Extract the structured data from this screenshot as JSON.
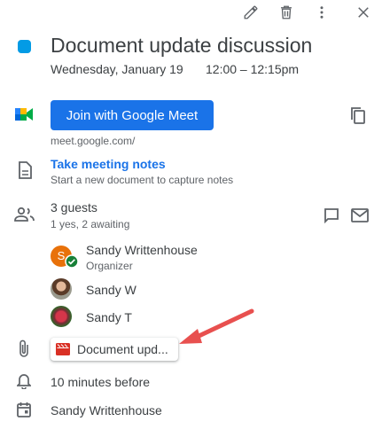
{
  "event": {
    "title": "Document update discussion",
    "date": "Wednesday, January 19",
    "time": "12:00 – 12:15pm",
    "color": "#039be5"
  },
  "meet": {
    "button_label": "Join with Google Meet",
    "link": "meet.google.com/"
  },
  "notes": {
    "title": "Take meeting notes",
    "subtitle": "Start a new document to capture notes"
  },
  "guests": {
    "count_label": "3 guests",
    "status_label": "1 yes, 2 awaiting",
    "list": [
      {
        "name": "Sandy Writtenhouse",
        "role": "Organizer",
        "initial": "S"
      },
      {
        "name": "Sandy W"
      },
      {
        "name": "Sandy T"
      }
    ]
  },
  "attachment": {
    "label": "Document upd..."
  },
  "reminder": {
    "label": "10 minutes before"
  },
  "calendar": {
    "owner": "Sandy Writtenhouse"
  },
  "icons": {
    "toolbar": [
      "pencil-icon",
      "trash-icon",
      "more-vert-icon",
      "close-icon"
    ],
    "rows": [
      "google-meet-icon",
      "document-icon",
      "people-icon",
      "paperclip-icon",
      "bell-icon",
      "calendar-icon"
    ]
  },
  "colors": {
    "accent": "#1a73e8",
    "annotation_arrow": "#e8504f",
    "organizer_avatar": "#e8710a",
    "accepted_check": "#188038"
  }
}
